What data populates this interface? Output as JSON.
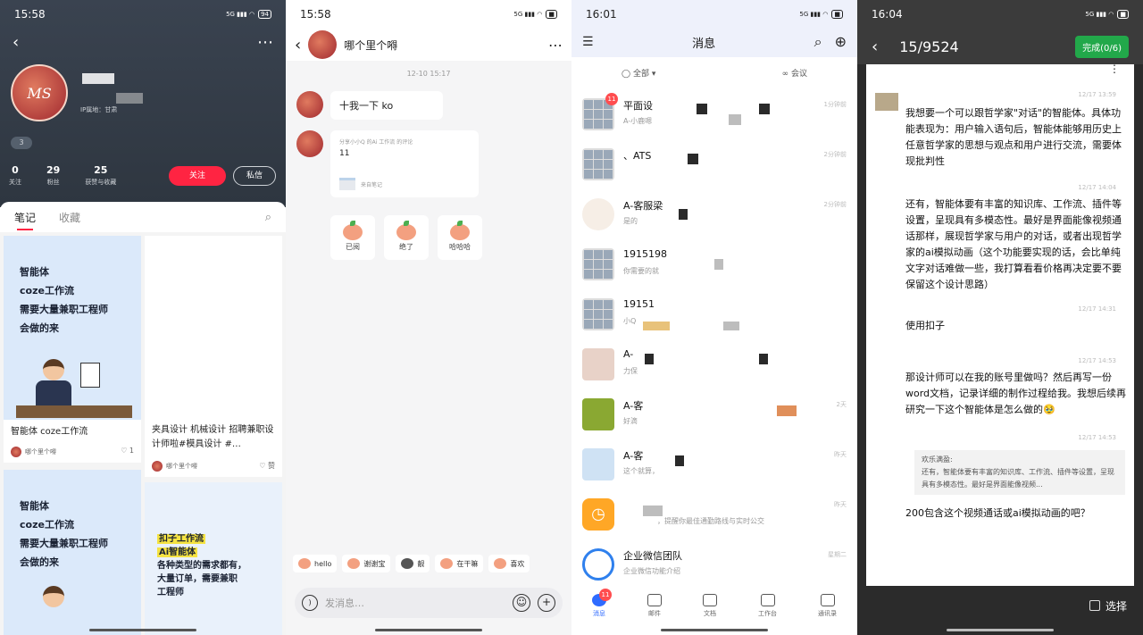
{
  "profile_screen": {
    "status_time": "15:58",
    "battery": "94",
    "location": "IP属地：甘肃",
    "badge": "3",
    "stats": [
      {
        "value": "0",
        "label": "关注"
      },
      {
        "value": "29",
        "label": "粉丝"
      },
      {
        "value": "25",
        "label": "获赞与收藏"
      }
    ],
    "follow_label": "关注",
    "message_label": "私信",
    "tabs": [
      "笔记",
      "收藏"
    ],
    "cover_text_1": [
      "智能体",
      "coze工作流",
      "需要大量兼职工程师",
      "会做的来"
    ],
    "note1_title": "智能体 coze工作流",
    "note1_author": "哪个里个嘚",
    "note1_likes": "1",
    "note2_title": "夹具设计 机械设计 招聘兼职设计师啦#模具设计 #…",
    "note2_author": "哪个里个嘚",
    "note2_likes": "赞",
    "cover_text_3": [
      "智能体",
      "coze工作流",
      "需要大量兼职工程师",
      "会做的来"
    ],
    "cover_text_4_hl": [
      "扣子工作流",
      "Ai智能体"
    ],
    "cover_text_4": [
      "各种类型的需求都有，",
      "大量订单，需要兼职",
      "工程师"
    ]
  },
  "chat_screen": {
    "status_time": "15:58",
    "title": "哪个里个嘚",
    "timestamp": "12-10 15:17",
    "bubble1": "十我一下 ko",
    "share_head": "分享小小Q 的Ai 工作流 的评论",
    "share_num": "11",
    "share_src": "来自笔记",
    "stickers": [
      "已阅",
      "绝了",
      "哈哈哈"
    ],
    "quick_replies": [
      "hello",
      "谢谢宝",
      "靓",
      "在干嘛",
      "喜欢"
    ],
    "input_placeholder": "发消息…"
  },
  "messages_screen": {
    "status_time": "16:01",
    "title": "消息",
    "filter_all": "全部",
    "filter_meeting": "会议",
    "conversations": [
      {
        "name": "平面设",
        "preview": "A-小鹿嗯",
        "time": "1分钟前",
        "badge": "11"
      },
      {
        "name": "、ATS",
        "preview": "",
        "time": "2分钟前",
        "badge": ""
      },
      {
        "name": "A-客服梁",
        "preview": "是的",
        "time": "2分钟前",
        "badge": ""
      },
      {
        "name": "1915198",
        "preview": "你需要的就",
        "time": "",
        "badge": ""
      },
      {
        "name": "19151",
        "preview": "小Q",
        "time": "",
        "badge": ""
      },
      {
        "name": "A-",
        "preview": "力保",
        "time": "",
        "badge": ""
      },
      {
        "name": "A-客",
        "preview": "好滴",
        "time": "2天",
        "badge": ""
      },
      {
        "name": "A-客",
        "preview": "这个就算，",
        "time": "昨天",
        "badge": ""
      },
      {
        "name": "",
        "preview": "，提醒你最佳通勤路线与实时公交",
        "time": "昨天",
        "badge": ""
      },
      {
        "name": "企业微信团队",
        "preview": "企业微信功能介绍",
        "time": "星期二",
        "badge": ""
      }
    ],
    "tabbar": [
      {
        "label": "消息",
        "badge": "11"
      },
      {
        "label": "邮件",
        "badge": ""
      },
      {
        "label": "文档",
        "badge": ""
      },
      {
        "label": "工作台",
        "badge": ""
      },
      {
        "label": "通讯录",
        "badge": ""
      }
    ]
  },
  "select_screen": {
    "status_time": "16:04",
    "counter": "15/9524",
    "done_label": "完成(0/6)",
    "messages": [
      {
        "time": "12/17 13:59",
        "text": "我想要一个可以跟哲学家\"对话\"的智能体。具体功能表现为：用户输入语句后，智能体能够用历史上任意哲学家的思想与观点和用户进行交流，需要体现批判性"
      },
      {
        "time": "12/17 14:04",
        "text": "还有，智能体要有丰富的知识库、工作流、插件等设置，呈现具有多模态性。最好是界面能像视频通话那样，展现哲学家与用户的对话，或者出现哲学家的ai模拟动画（这个功能要实现的话，会比单纯文字对话难做一些，我打算看看价格再决定要不要保留这个设计思路）"
      },
      {
        "time": "12/17 14:31",
        "text": "使用扣子"
      },
      {
        "time": "12/17 14:53",
        "text": "那设计师可以在我的账号里做吗？然后再写一份word文档，记录详细的制作过程给我。我想后续再研究一下这个智能体是怎么做的🥹"
      },
      {
        "time": "12/17 14:53",
        "text": "200包含这个视频通话或ai模拟动画的吧？"
      }
    ],
    "quote_head": "欢乐满盈:",
    "quote_body": "还有，智能体要有丰富的知识库、工作流、插件等设置，呈现具有多模态性。最好是界面能像视频...",
    "select_label": "选择"
  }
}
